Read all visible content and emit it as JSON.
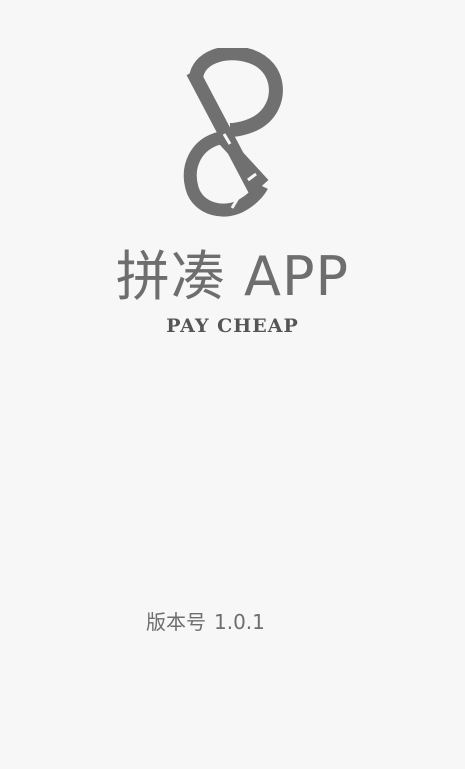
{
  "splash": {
    "logo_icon": "pp-monogram-icon",
    "app_name": "拼凑 APP",
    "tagline": "PAY CHEAP",
    "version_label": "版本号",
    "version_number": "1.0.1"
  },
  "colors": {
    "background": "#f7f7f7",
    "logo": "#707070",
    "text": "#6e6e6e"
  }
}
